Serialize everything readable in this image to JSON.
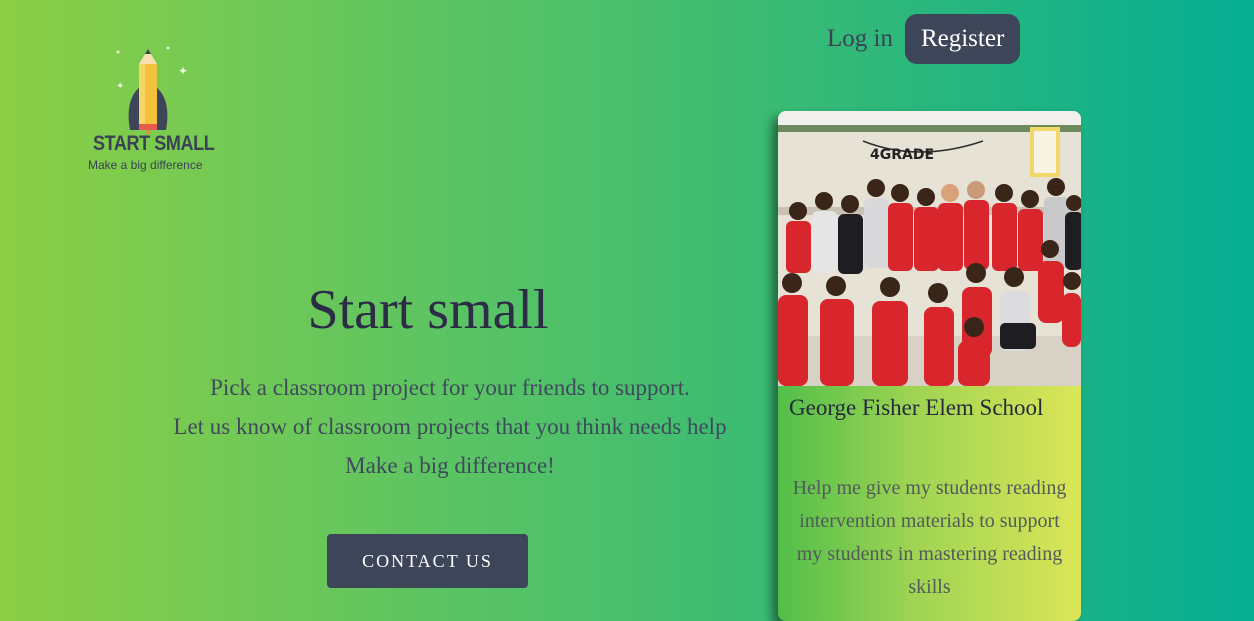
{
  "logo": {
    "name": "START SMALL",
    "tagline": "Make a big difference"
  },
  "nav": {
    "login": "Log in",
    "register": "Register"
  },
  "hero": {
    "title": "Start small",
    "lines": [
      "Pick a classroom project for your friends to support.",
      "Let us know of classroom projects that you think needs help",
      "Make a big difference!"
    ],
    "cta": "CONTACT US"
  },
  "card": {
    "banner": "4GRADE",
    "school": "George Fisher Elem School",
    "description": "Help me give my students reading intervention materials to support my students in mastering reading skills"
  },
  "colors": {
    "dark": "#3d4558",
    "gradient_start": "#8ccf45",
    "gradient_end": "#05ae93"
  }
}
